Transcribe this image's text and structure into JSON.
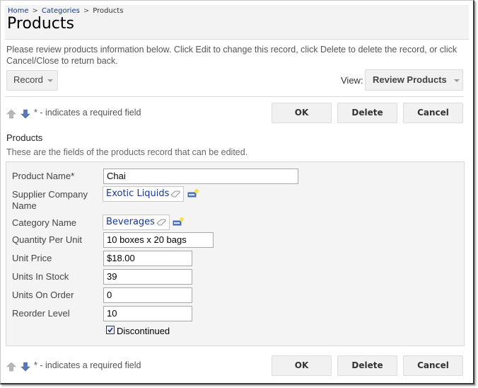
{
  "breadcrumb": [
    {
      "label": "Home",
      "link": true
    },
    {
      "label": "Categories",
      "link": true
    },
    {
      "label": "Products",
      "link": false
    }
  ],
  "breadcrumb_separator": ">",
  "page_title": "Products",
  "description": "Please review products information below. Click Edit to change this record, click Delete to delete the record, or click Cancel/Close to return back.",
  "toolbar": {
    "record_label": "Record",
    "view_label": "View:",
    "view_value": "Review Products"
  },
  "required_note": "* - indicates a required field",
  "actions": {
    "ok": "OK",
    "delete": "Delete",
    "cancel": "Cancel"
  },
  "category": {
    "title": "Products",
    "description": "These are the fields of the products record that can be edited."
  },
  "fields": {
    "product_name": {
      "label": "Product Name",
      "required_mark": "*",
      "value": "Chai"
    },
    "supplier": {
      "label": "Supplier Company Name",
      "value": "Exotic Liquids"
    },
    "category_name": {
      "label": "Category Name",
      "value": "Beverages"
    },
    "quantity_per_unit": {
      "label": "Quantity Per Unit",
      "value": "10 boxes x 20 bags"
    },
    "unit_price": {
      "label": "Unit Price",
      "value": "$18.00"
    },
    "units_in_stock": {
      "label": "Units In Stock",
      "value": "39"
    },
    "units_on_order": {
      "label": "Units On Order",
      "value": "0"
    },
    "reorder_level": {
      "label": "Reorder Level",
      "value": "10"
    },
    "discontinued": {
      "label": "Discontinued",
      "checked": true
    }
  },
  "icons": {
    "move_up": "arrow-up-icon",
    "move_down": "arrow-down-icon",
    "clear": "eraser-icon",
    "new": "new-item-icon"
  }
}
